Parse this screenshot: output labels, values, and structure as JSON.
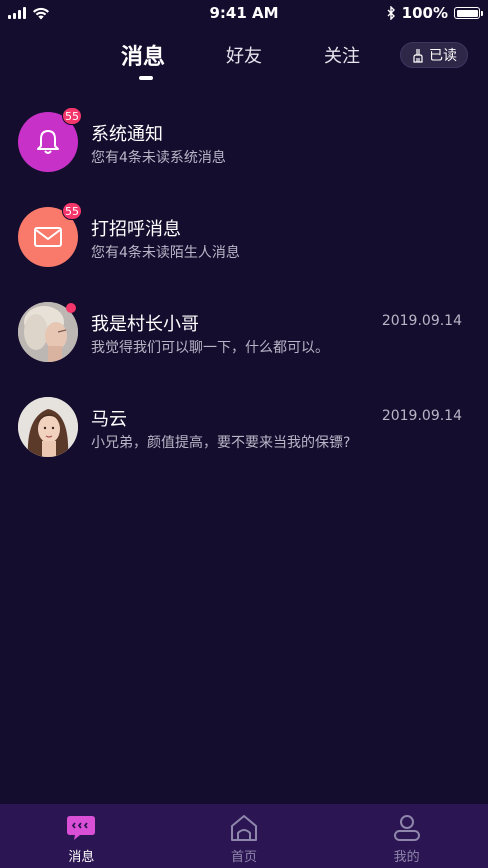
{
  "status_bar": {
    "time": "9:41 AM",
    "battery": "100%"
  },
  "tabs": [
    {
      "label": "消息",
      "active": true
    },
    {
      "label": "好友",
      "active": false
    },
    {
      "label": "关注",
      "active": false
    }
  ],
  "read_button": {
    "label": "已读",
    "icon": "broom-icon"
  },
  "messages": [
    {
      "title": "系统通知",
      "subtitle": "您有4条未读系统消息",
      "date": "",
      "badge": "55",
      "icon": "bell-icon",
      "color": "#c731c8"
    },
    {
      "title": "打招呼消息",
      "subtitle": "您有4条未读陌生人消息",
      "date": "",
      "badge": "55",
      "icon": "envelope-icon",
      "color": "#f97a6b"
    },
    {
      "title": "我是村长小哥",
      "subtitle": "我觉得我们可以聊一下，什么都可以。",
      "date": "2019.09.14",
      "badge": "",
      "icon": "user-avatar"
    },
    {
      "title": "马云",
      "subtitle": "小兄弟，颜值提高，要不要来当我的保镖?",
      "date": "2019.09.14",
      "badge": "",
      "icon": "user-avatar"
    }
  ],
  "bottom_nav": [
    {
      "label": "消息",
      "icon": "chat-icon",
      "active": true
    },
    {
      "label": "首页",
      "icon": "home-icon",
      "active": false
    },
    {
      "label": "我的",
      "icon": "profile-icon",
      "active": false
    }
  ],
  "colors": {
    "background": "#150d2e",
    "nav_background": "#2b1552",
    "badge": "#f5366a",
    "active_nav_icon": "#d94fd6"
  }
}
